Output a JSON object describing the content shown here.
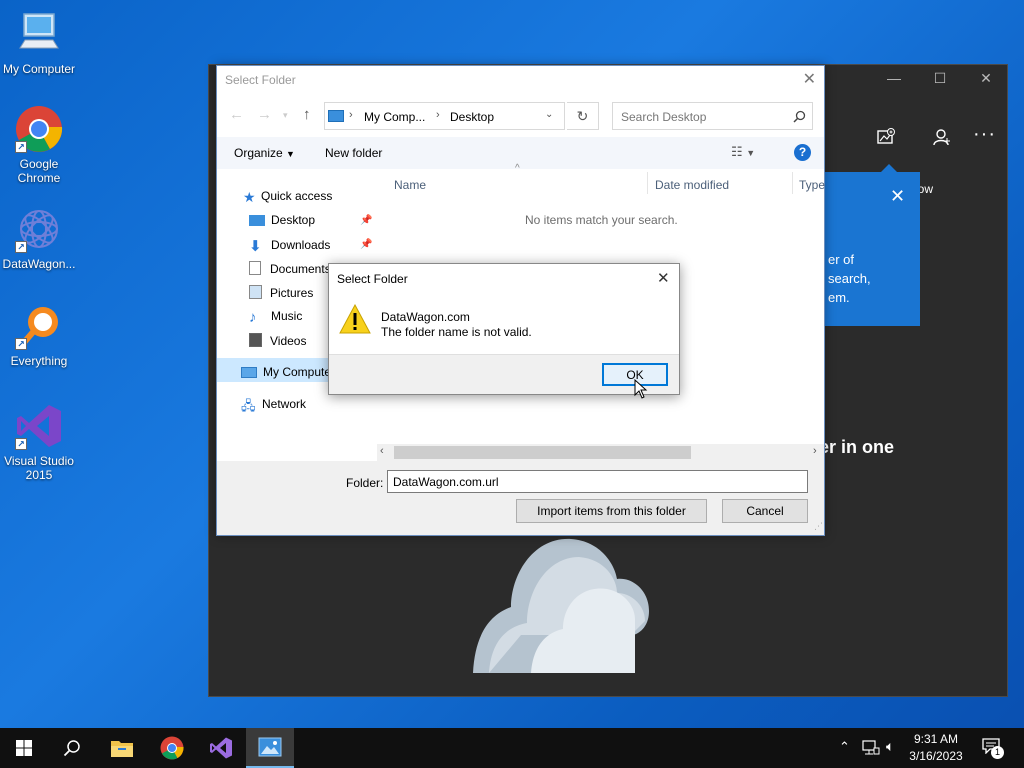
{
  "desktop": {
    "icons": [
      {
        "label": "My Computer"
      },
      {
        "label": "Google Chrome"
      },
      {
        "label": "DataWagon..."
      },
      {
        "label": "Everything"
      },
      {
        "label": "Visual Studio 2015"
      }
    ]
  },
  "photos_app": {
    "tip_text_1": "er of",
    "tip_text_2": "search,",
    "tip_text_3": "em.",
    "show_label": "how",
    "heading_fragment": "er in one"
  },
  "dialog": {
    "title": "Select Folder",
    "address": {
      "segment_1": "My Comp...",
      "segment_2": "Desktop"
    },
    "search_placeholder": "Search Desktop",
    "organize_label": "Organize",
    "new_folder_label": "New folder",
    "help_label": "?",
    "nav": {
      "quick_access": "Quick access",
      "desktop": "Desktop",
      "downloads": "Downloads",
      "documents": "Documents",
      "pictures": "Pictures",
      "music": "Music",
      "videos": "Videos",
      "my_computer": "My Computer",
      "network": "Network"
    },
    "columns": {
      "name": "Name",
      "date_modified": "Date modified",
      "type": "Type"
    },
    "empty_text": "No items match your search.",
    "folder_label": "Folder:",
    "folder_value": "DataWagon.com.url",
    "import_button": "Import items from this folder",
    "cancel_button": "Cancel"
  },
  "message_box": {
    "title": "Select Folder",
    "line_1": "DataWagon.com",
    "line_2": "The folder name is not valid.",
    "ok_button": "OK"
  },
  "taskbar": {
    "time": "9:31 AM",
    "date": "3/16/2023",
    "notification_count": "1"
  },
  "colors": {
    "desktop_bg": "#0a63c8",
    "taskbar_bg": "#101010",
    "photos_bg": "#2b2b2b",
    "accent": "#1a75d2"
  }
}
